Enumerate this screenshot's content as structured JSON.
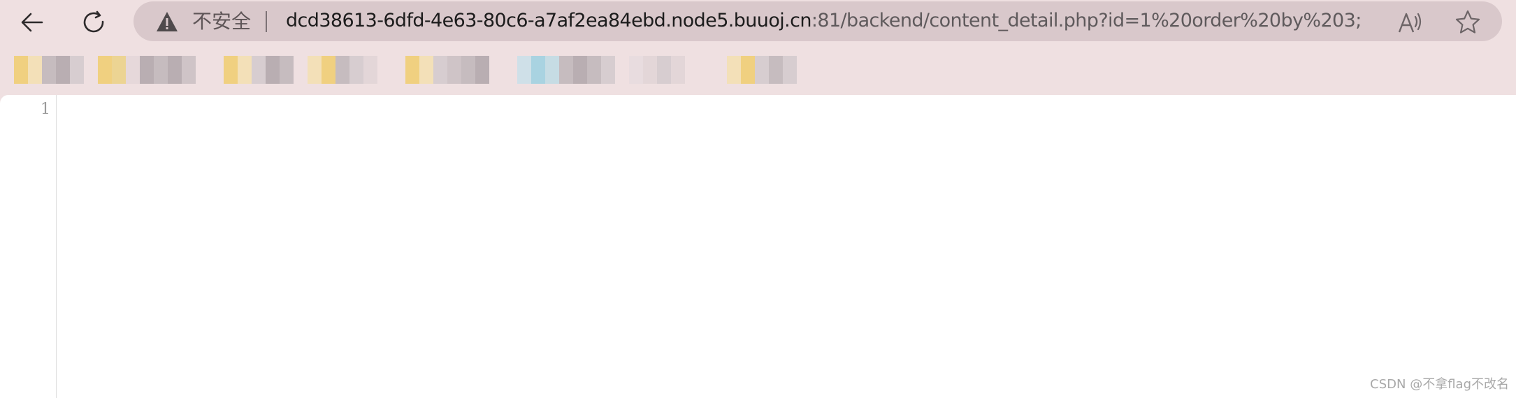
{
  "browser": {
    "address_bar": {
      "security_label": "不安全",
      "url_host": "dcd38613-6dfd-4e63-80c6-a7af2ea84ebd.node5.buuoj.cn",
      "url_rest": ":81/backend/content_detail.php?id=1%20order%20by%203;"
    },
    "icons": {
      "back": "back-arrow-icon",
      "reload": "reload-icon",
      "warning": "warning-icon",
      "read_aloud": "read-aloud-icon",
      "favorite": "star-icon"
    }
  },
  "bookmarks": {
    "count_visible": 8,
    "note_colors": [
      "#f0d080",
      "#c8c0c3",
      "#a9d3e1"
    ]
  },
  "page": {
    "line_number": "1",
    "body_text": ""
  },
  "watermark": "CSDN @不拿flag不改名"
}
